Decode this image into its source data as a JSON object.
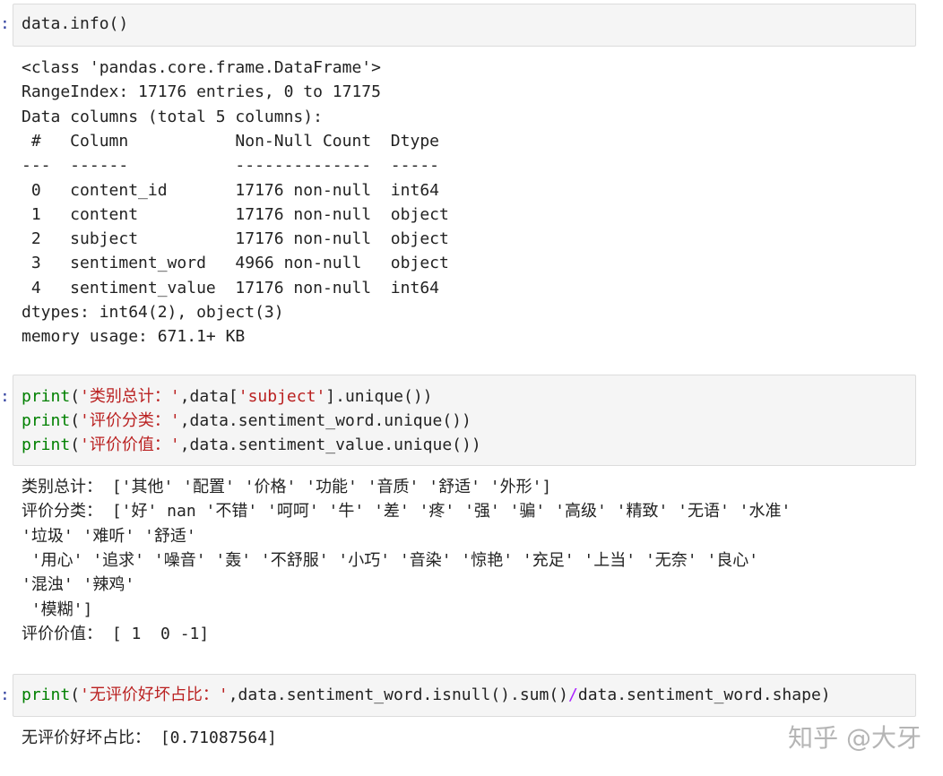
{
  "cells": [
    {
      "input": {
        "lines": [
          [
            {
              "t": "data.info()",
              "c": "plain"
            }
          ]
        ]
      },
      "output": [
        "<class 'pandas.core.frame.DataFrame'>",
        "RangeIndex: 17176 entries, 0 to 17175",
        "Data columns (total 5 columns):",
        " #   Column           Non-Null Count  Dtype ",
        "---  ------           --------------  ----- ",
        " 0   content_id       17176 non-null  int64 ",
        " 1   content          17176 non-null  object",
        " 2   subject          17176 non-null  object",
        " 3   sentiment_word   4966 non-null   object",
        " 4   sentiment_value  17176 non-null  int64 ",
        "dtypes: int64(2), object(3)",
        "memory usage: 671.1+ KB"
      ]
    },
    {
      "input": {
        "lines": [
          [
            {
              "t": "print",
              "c": "kw"
            },
            {
              "t": "(",
              "c": "plain"
            },
            {
              "t": "'类别总计：'",
              "c": "str"
            },
            {
              "t": ",data[",
              "c": "plain"
            },
            {
              "t": "'subject'",
              "c": "str"
            },
            {
              "t": "].unique())",
              "c": "plain"
            }
          ],
          [
            {
              "t": "print",
              "c": "kw"
            },
            {
              "t": "(",
              "c": "plain"
            },
            {
              "t": "'评价分类：'",
              "c": "str"
            },
            {
              "t": ",data.sentiment_word.unique())",
              "c": "plain"
            }
          ],
          [
            {
              "t": "print",
              "c": "kw"
            },
            {
              "t": "(",
              "c": "plain"
            },
            {
              "t": "'评价价值：'",
              "c": "str"
            },
            {
              "t": ",data.sentiment_value.unique())",
              "c": "plain"
            }
          ]
        ]
      },
      "output": [
        "类别总计： ['其他' '配置' '价格' '功能' '音质' '舒适' '外形']",
        "评价分类： ['好' nan '不错' '呵呵' '牛' '差' '疼' '强' '骗' '高级' '精致' '无语' '水准'",
        "'垃圾' '难听' '舒适'",
        " '用心' '追求' '噪音' '轰' '不舒服' '小巧' '音染' '惊艳' '充足' '上当' '无奈' '良心'",
        "'混浊' '辣鸡'",
        " '模糊']",
        "评价价值： [ 1  0 -1]"
      ]
    },
    {
      "input": {
        "lines": [
          [
            {
              "t": "print",
              "c": "kw"
            },
            {
              "t": "(",
              "c": "plain"
            },
            {
              "t": "'无评价好坏占比：'",
              "c": "str"
            },
            {
              "t": ",data.sentiment_word.isnull().sum()",
              "c": "plain"
            },
            {
              "t": "/",
              "c": "op"
            },
            {
              "t": "data.sentiment_word.shape)",
              "c": "plain"
            }
          ]
        ]
      },
      "output": [
        "无评价好坏占比： [0.71087564]"
      ]
    }
  ],
  "prompt_char": ":",
  "watermark": "知乎 @大牙"
}
